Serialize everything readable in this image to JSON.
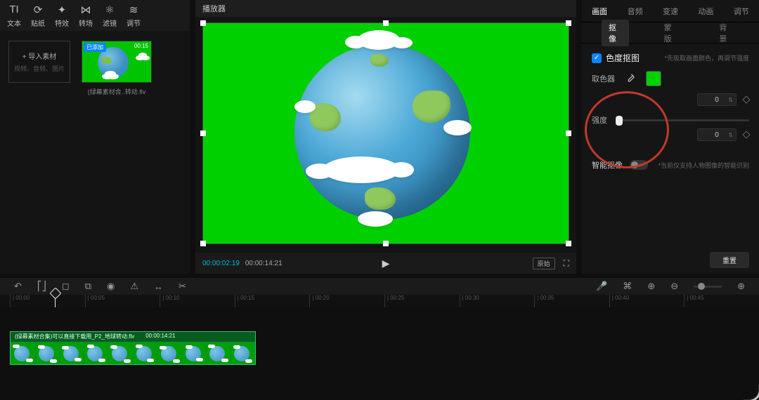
{
  "toolbar": {
    "items": [
      {
        "icon": "TI",
        "label": "文本"
      },
      {
        "icon": "⟳",
        "label": "贴纸"
      },
      {
        "icon": "✦",
        "label": "特效"
      },
      {
        "icon": "⋈",
        "label": "转场"
      },
      {
        "icon": "⚛",
        "label": "滤镜"
      },
      {
        "icon": "≋",
        "label": "调节"
      }
    ]
  },
  "media": {
    "import_label": "+ 导入素材",
    "import_sub": "视频、音频、图片",
    "item_badge": "已添加",
    "item_dur": "00:15",
    "item_name": "(绿幕素材合..转动.flv"
  },
  "preview": {
    "title": "播放器",
    "tc_cur": "00:00:02:19",
    "tc_total": "00:00:14:21",
    "ratio": "原始"
  },
  "inspector": {
    "tabs": [
      "画面",
      "音频",
      "变速",
      "动画",
      "调节"
    ],
    "active_tab": 0,
    "subtabs": [
      "抠像",
      "蒙版",
      "背景"
    ],
    "active_subtab": 0,
    "chroma_label": "色度抠图",
    "chroma_hint": "*先吸取画面颜色，再调节强度",
    "picker_label": "取色器",
    "picked_color": "#00d000",
    "strength_label": "强度",
    "num_a": "0",
    "num_b": "0",
    "smart_label": "智能抠像",
    "smart_hint": "*当前仅支持人物图像的智能识别",
    "reset": "重置"
  },
  "timeline": {
    "ticks": [
      "| 00:00",
      "| 00:05",
      "| 00:10",
      "| 00:15",
      "| 00:20",
      "| 00:25",
      "| 00:30",
      "| 00:35",
      "| 00:40",
      "| 00:45"
    ],
    "clip_name": "(绿幕素材合集)可以直接下载用_P2_地球转动.flv",
    "clip_dur": "00:00:14:21"
  }
}
